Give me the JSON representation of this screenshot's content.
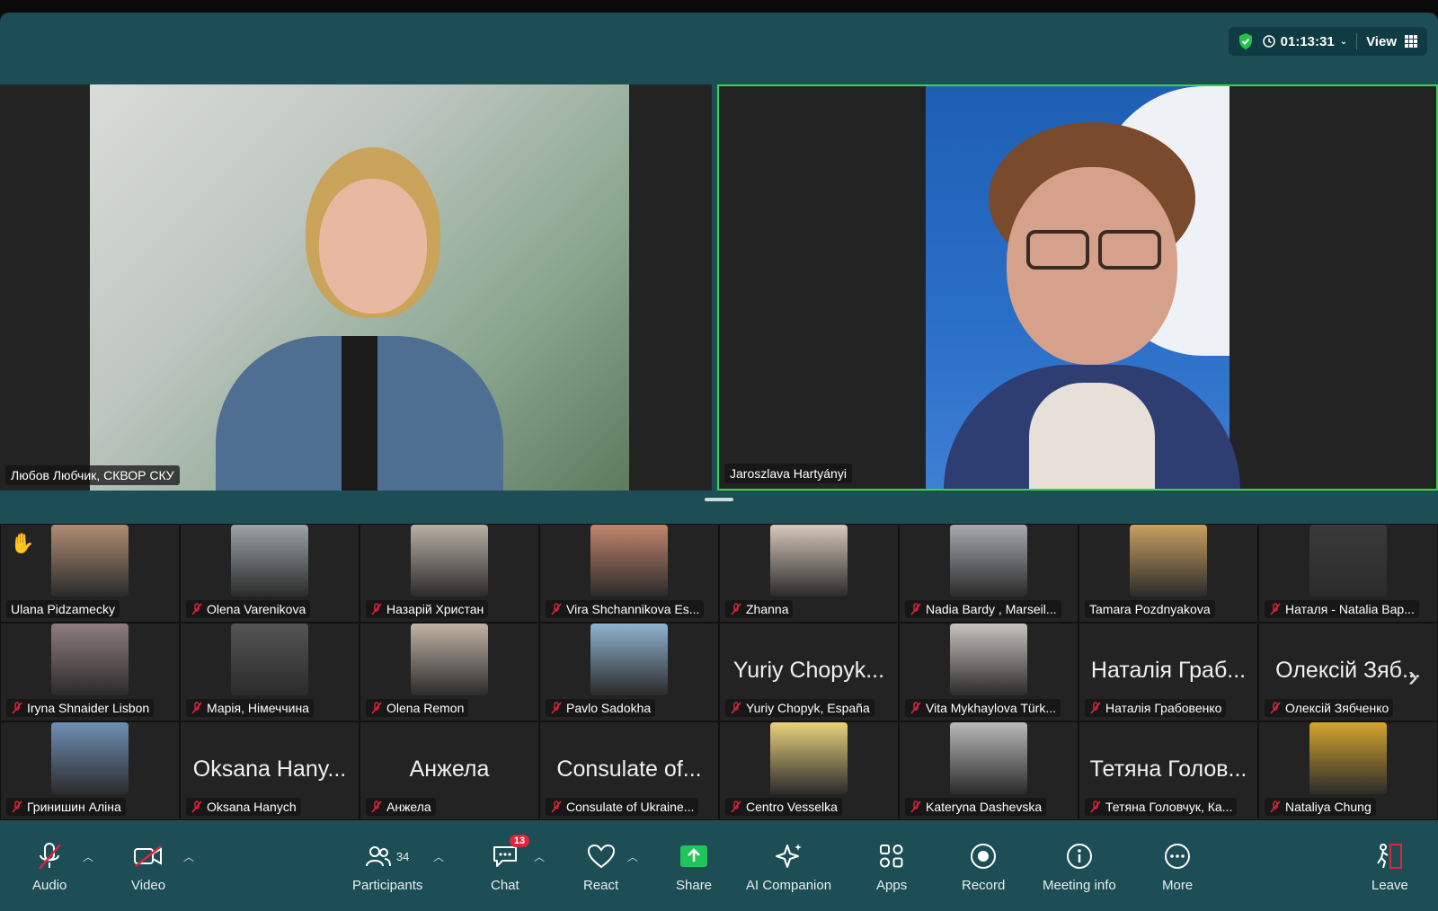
{
  "status": {
    "timer": "01:13:31",
    "view_label": "View"
  },
  "speakers": [
    {
      "name": "Любов Любчик, СКВОР СКУ"
    },
    {
      "name": "Jaroszlava Hartyányi"
    }
  ],
  "gallery": [
    {
      "label": "Ulana Pidzamecky",
      "muted": false,
      "hand": true
    },
    {
      "label": "Olena Varenikova",
      "muted": true
    },
    {
      "label": "Назарій Христан",
      "muted": true
    },
    {
      "label": "Vira Shchannikova Es...",
      "muted": true
    },
    {
      "label": "Zhanna",
      "muted": true
    },
    {
      "label": "Nadia Bardy , Marseil...",
      "muted": true
    },
    {
      "label": "Tamara Pozdnyakova",
      "muted": false
    },
    {
      "label": "Наталя - Natalia Вар...",
      "muted": true
    },
    {
      "label": "Iryna Shnaider Lisbon",
      "muted": true
    },
    {
      "label": "Марія, Німеччина",
      "muted": true
    },
    {
      "label": "Olena Remon",
      "muted": true
    },
    {
      "label": "Pavlo Sadokha",
      "muted": true
    },
    {
      "label": "Yuriy Chopyk, España",
      "muted": true,
      "big": "Yuriy Chopyk..."
    },
    {
      "label": "Vita Mykhaylova Türk...",
      "muted": true
    },
    {
      "label": "Наталія Грабовенко",
      "muted": true,
      "big": "Наталія Граб..."
    },
    {
      "label": "Олексій Зябченко",
      "muted": true,
      "big": "Олексій Зяб..."
    },
    {
      "label": "Гринишин Аліна",
      "muted": true
    },
    {
      "label": "Oksana Hanych",
      "muted": true,
      "big": "Oksana Hany..."
    },
    {
      "label": "Анжела",
      "muted": true,
      "big": "Анжела"
    },
    {
      "label": "Consulate of Ukraine...",
      "muted": true,
      "big": "Consulate of..."
    },
    {
      "label": "Centro Vesselka",
      "muted": true
    },
    {
      "label": "Kateryna Dashevska",
      "muted": true
    },
    {
      "label": "Тетяна Головчук, Ка...",
      "muted": true,
      "big": "Тетяна Голов..."
    },
    {
      "label": "Nataliya Chung",
      "muted": true
    }
  ],
  "toolbar": {
    "audio": "Audio",
    "video": "Video",
    "participants": "Participants",
    "participants_count": "34",
    "chat": "Chat",
    "chat_badge": "13",
    "react": "React",
    "share": "Share",
    "ai": "AI Companion",
    "apps": "Apps",
    "record": "Record",
    "meeting_info": "Meeting info",
    "more": "More",
    "leave": "Leave"
  }
}
